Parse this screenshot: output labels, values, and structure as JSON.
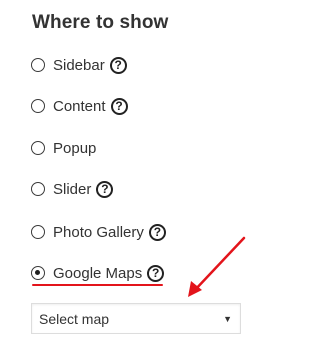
{
  "section": {
    "title": "Where to show"
  },
  "options": [
    {
      "label": "Sidebar",
      "checked": false
    },
    {
      "label": "Content",
      "checked": false
    },
    {
      "label": "Popup",
      "checked": false
    },
    {
      "label": "Slider",
      "checked": false
    },
    {
      "label": "Photo Gallery",
      "checked": false
    },
    {
      "label": "Google Maps",
      "checked": true
    }
  ],
  "help_icon": {
    "glyph": "?"
  },
  "map_select": {
    "value": "Select map",
    "caret": "▼"
  },
  "annotation": {
    "color": "#e3141b",
    "icon": "arrow-annotation-icon"
  }
}
